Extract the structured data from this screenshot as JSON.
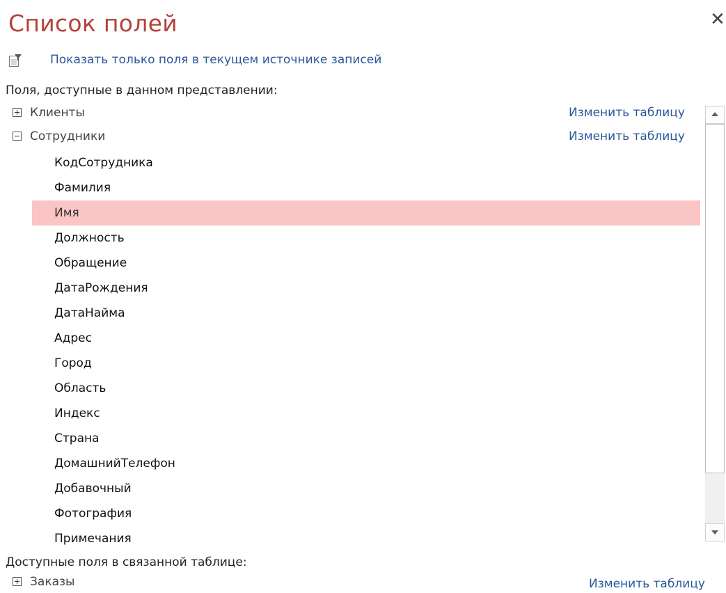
{
  "pane": {
    "title": "Список полей",
    "close_glyph": "✕",
    "show_only_link": "Показать только поля в текущем источнике записей",
    "available_label": "Поля, доступные в данном представлении:",
    "related_label": "Доступные поля в связанной таблице:"
  },
  "tables": [
    {
      "name": "Клиенты",
      "expanded": false,
      "edit_label": "Изменить таблицу"
    },
    {
      "name": "Сотрудники",
      "expanded": true,
      "edit_label": "Изменить таблицу"
    }
  ],
  "fields": [
    {
      "label": "КодСотрудника"
    },
    {
      "label": "Фамилия"
    },
    {
      "label": "Имя",
      "selected": true
    },
    {
      "label": "Должность"
    },
    {
      "label": "Обращение"
    },
    {
      "label": "ДатаРождения"
    },
    {
      "label": "ДатаНайма"
    },
    {
      "label": "Адрес"
    },
    {
      "label": "Город"
    },
    {
      "label": "Область"
    },
    {
      "label": "Индекс"
    },
    {
      "label": "Страна"
    },
    {
      "label": "ДомашнийТелефон"
    },
    {
      "label": "Добавочный"
    },
    {
      "label": "Фотография"
    },
    {
      "label": "Примечания"
    }
  ],
  "related_tables": [
    {
      "name": "Заказы",
      "expanded": false,
      "edit_label": "Изменить таблицу"
    }
  ],
  "icons": {
    "close": "close-icon",
    "filter": "filter-fields-icon",
    "expand": "expand-plus-icon",
    "collapse": "collapse-minus-icon",
    "scroll_up": "scroll-up-arrow-icon",
    "scroll_down": "scroll-down-arrow-icon"
  },
  "colors": {
    "title": "#b5413b",
    "link": "#2b579a",
    "selected_row": "#fbc5c5"
  }
}
